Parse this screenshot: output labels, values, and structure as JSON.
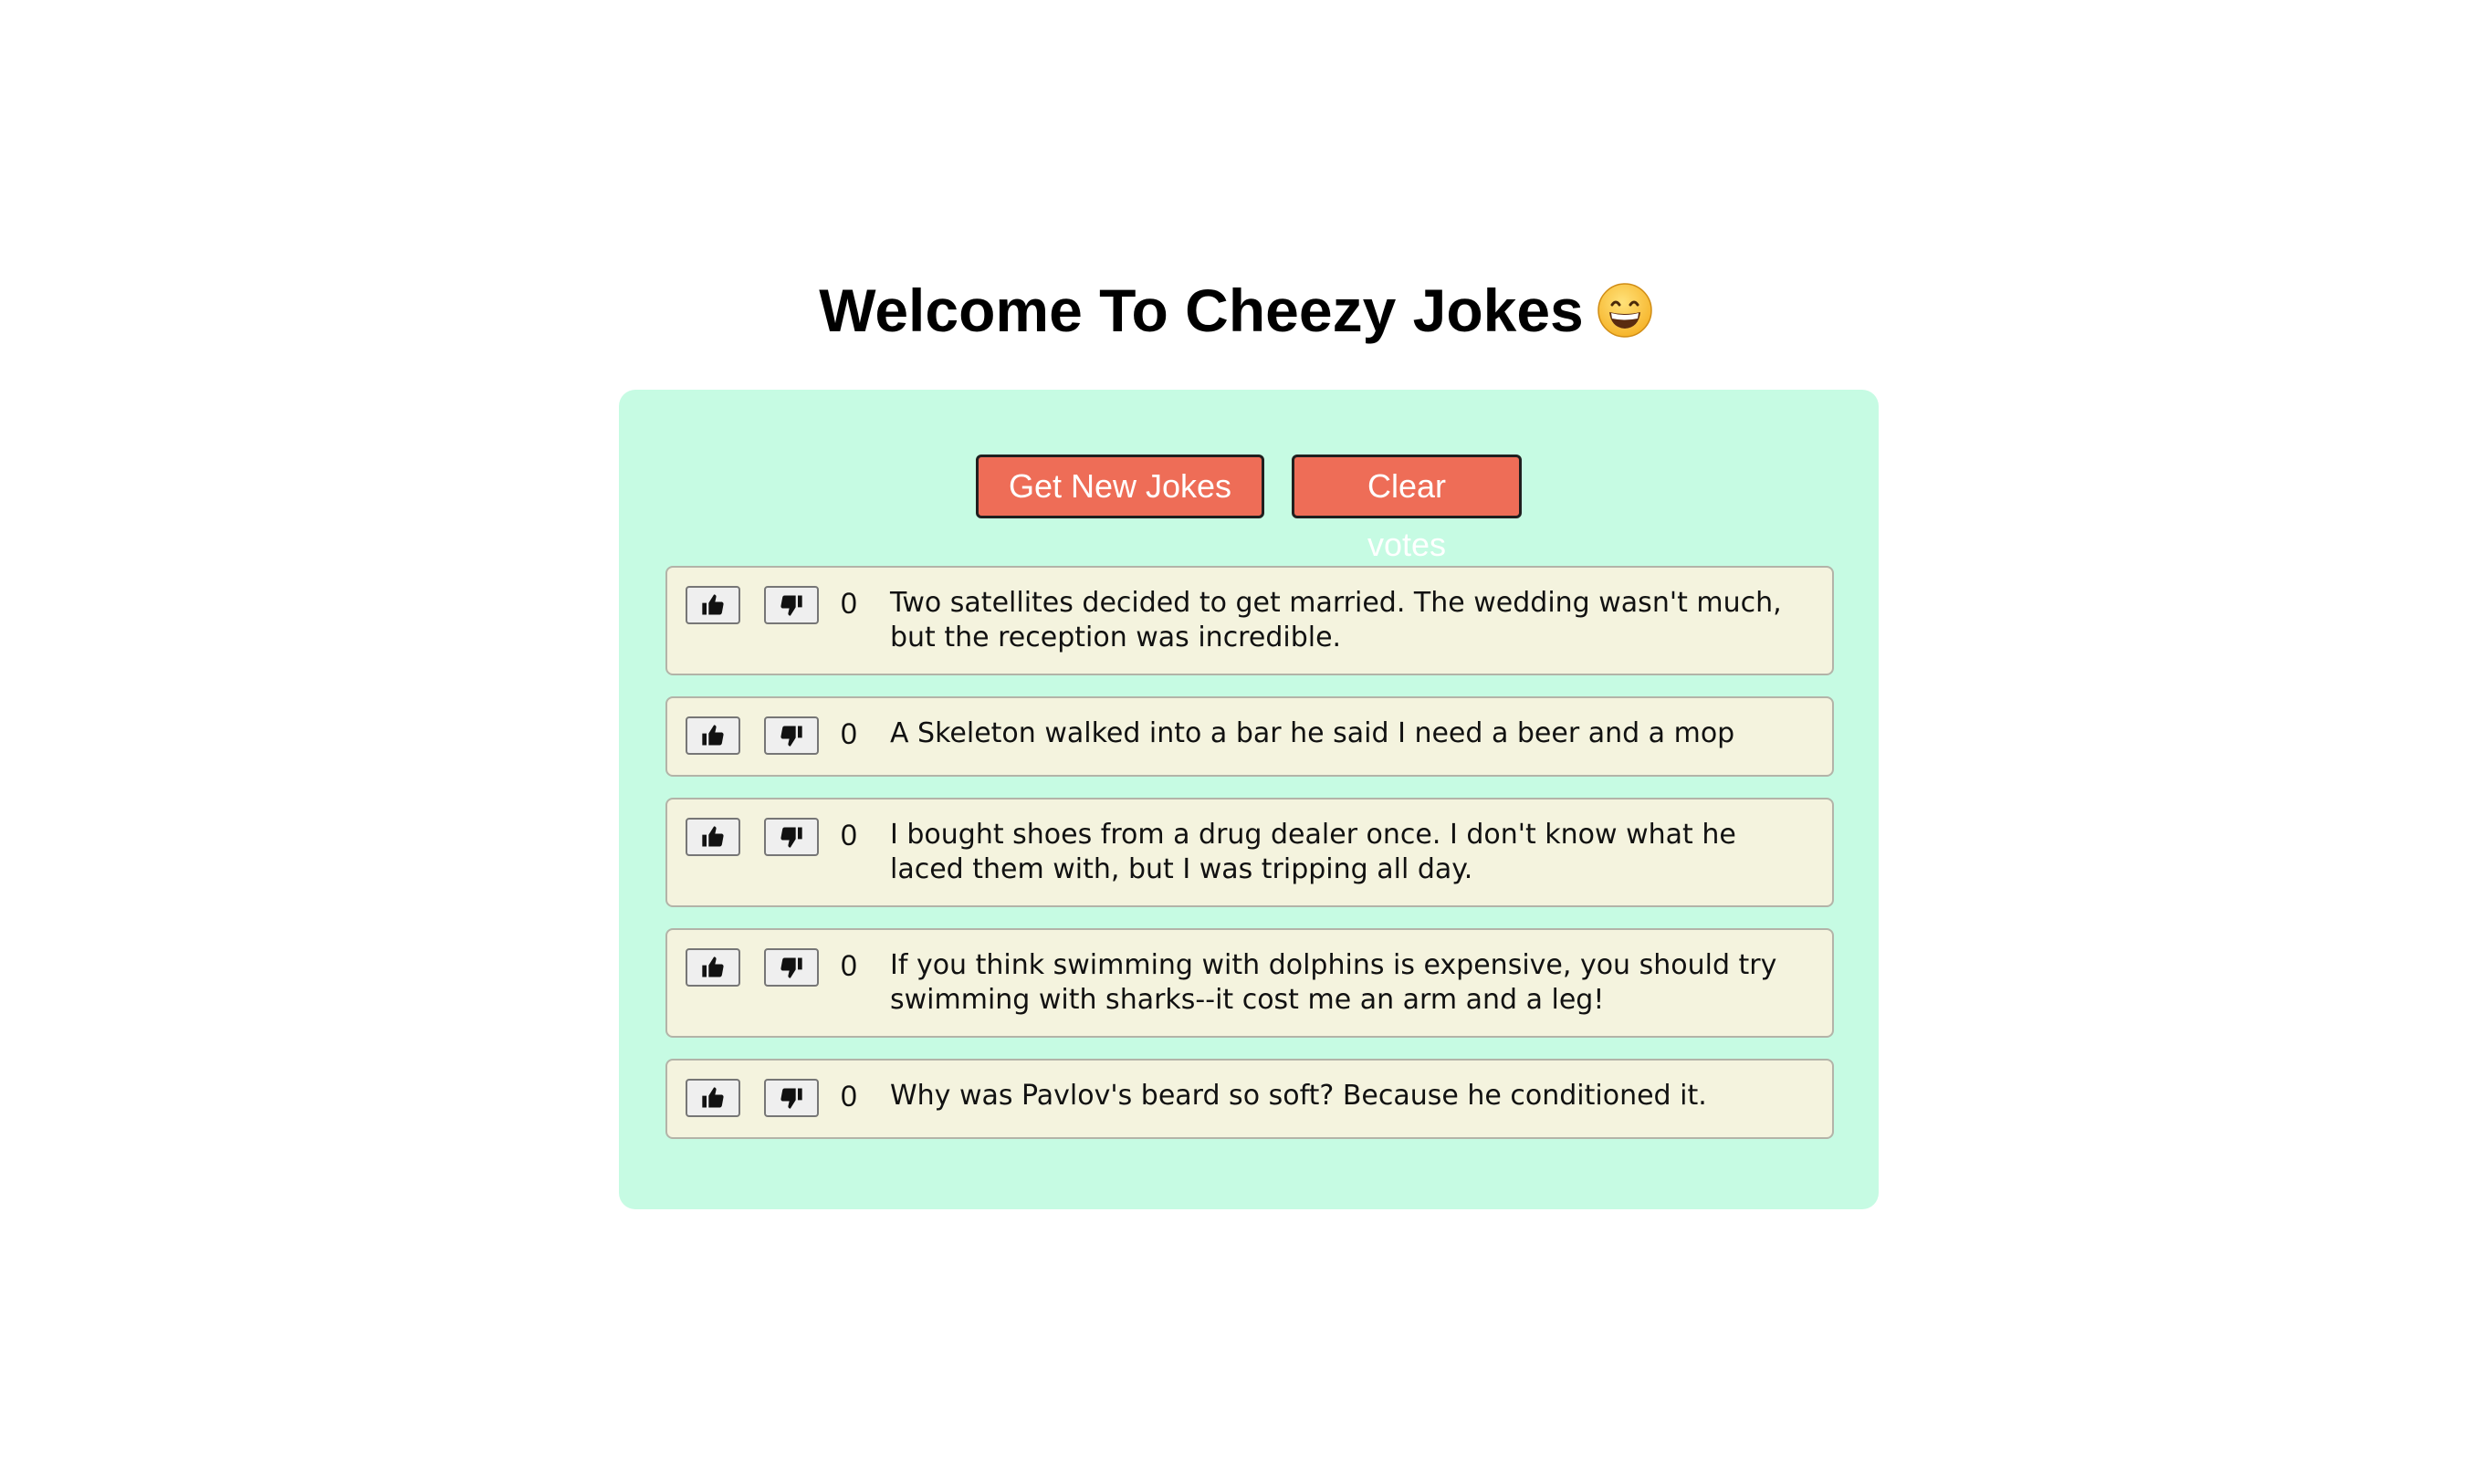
{
  "title": "Welcome To Cheezy Jokes",
  "title_emoji": "grinning-face-with-smiling-eyes-icon",
  "buttons": {
    "get_new_jokes": "Get New Jokes",
    "clear_votes": "Clear votes"
  },
  "jokes": [
    {
      "votes": "0",
      "text": "Two satellites decided to get married. The wedding wasn't much, but the reception was incredible."
    },
    {
      "votes": "0",
      "text": "A Skeleton walked into a bar he said I need a beer and a mop"
    },
    {
      "votes": "0",
      "text": "I bought shoes from a drug dealer once. I don't know what he laced them with, but I was tripping all day."
    },
    {
      "votes": "0",
      "text": "If you think swimming with dolphins is expensive, you should try swimming with sharks--it cost me an arm and a leg!"
    },
    {
      "votes": "0",
      "text": "Why was Pavlov's beard so soft? Because he conditioned it."
    }
  ],
  "icons": {
    "upvote": "thumbs-up-icon",
    "downvote": "thumbs-down-icon"
  },
  "colors": {
    "panel_bg": "#c6fbe3",
    "button_bg": "#ee6d57",
    "joke_bg": "#f4f3de"
  }
}
